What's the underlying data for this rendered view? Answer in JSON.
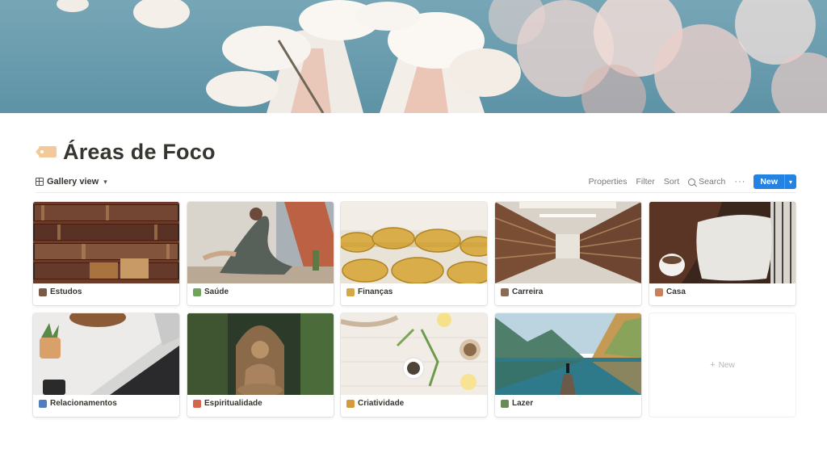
{
  "page": {
    "title": "Áreas de Foco",
    "icon": "label-tag-icon"
  },
  "toolbar": {
    "view_label": "Gallery view",
    "properties": "Properties",
    "filter": "Filter",
    "sort": "Sort",
    "search": "Search",
    "more": "···",
    "new": "New"
  },
  "gallery": {
    "cards": [
      {
        "label": "Estudos",
        "icon": "books-emoji",
        "image": "bookshelf"
      },
      {
        "label": "Saúde",
        "icon": "herb-emoji",
        "image": "yoga"
      },
      {
        "label": "Finanças",
        "icon": "money-bag-emoji",
        "image": "gold-coins"
      },
      {
        "label": "Carreira",
        "icon": "person-emoji",
        "image": "library-aisle"
      },
      {
        "label": "Casa",
        "icon": "house-emoji",
        "image": "leather-sofa"
      },
      {
        "label": "Relacionamentos",
        "icon": "people-emoji",
        "image": "laptop-desk"
      },
      {
        "label": "Espiritualidade",
        "icon": "meditation-emoji",
        "image": "buddha-statue"
      },
      {
        "label": "Criatividade",
        "icon": "palette-emoji",
        "image": "herbs-table"
      },
      {
        "label": "Lazer",
        "icon": "camping-emoji",
        "image": "lake-mountains"
      }
    ],
    "add_new": "New"
  },
  "colors": {
    "accent": "#2383e2",
    "text": "#37352f",
    "muted": "#787774"
  }
}
